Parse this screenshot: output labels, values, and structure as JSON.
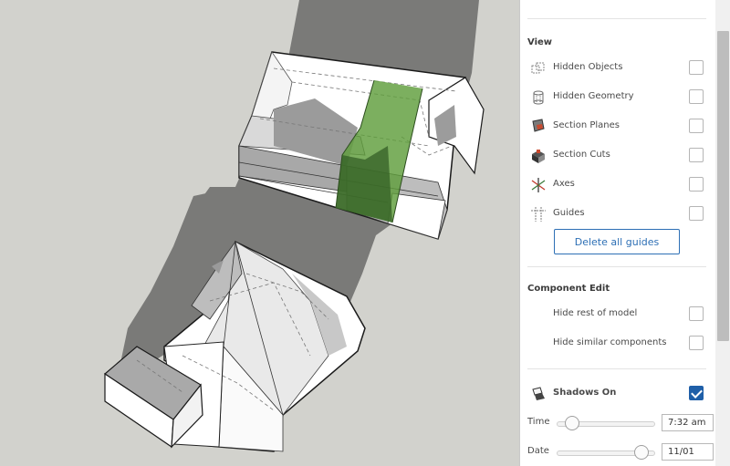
{
  "viewport": {
    "background": "#d2d2cd",
    "selection_color": "#5f9e3c"
  },
  "panel": {
    "view": {
      "title": "View",
      "items": [
        {
          "label": "Hidden Objects",
          "icon": "hidden-objects-icon",
          "checked": false
        },
        {
          "label": "Hidden Geometry",
          "icon": "hidden-geometry-icon",
          "checked": false
        },
        {
          "label": "Section Planes",
          "icon": "section-planes-icon",
          "checked": false
        },
        {
          "label": "Section Cuts",
          "icon": "section-cuts-icon",
          "checked": false
        },
        {
          "label": "Axes",
          "icon": "axes-icon",
          "checked": false
        },
        {
          "label": "Guides",
          "icon": "guides-icon",
          "checked": false
        }
      ],
      "delete_guides_label": "Delete all guides"
    },
    "component_edit": {
      "title": "Component Edit",
      "items": [
        {
          "label": "Hide rest of model",
          "checked": false
        },
        {
          "label": "Hide similar components",
          "checked": false
        }
      ]
    },
    "shadows": {
      "label": "Shadows On",
      "icon": "shadows-icon",
      "checked": true,
      "time_label": "Time",
      "time_value": "7:32 am",
      "time_position": 0.16,
      "date_label": "Date",
      "date_value": "11/01",
      "date_position": 0.86
    },
    "accent_color": "#1f5fa8"
  }
}
